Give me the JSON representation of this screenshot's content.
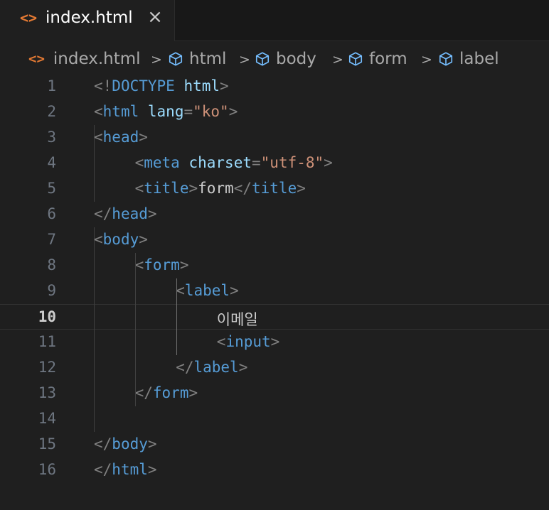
{
  "tab": {
    "icon": "<>",
    "label": "index.html",
    "close": "×"
  },
  "breadcrumb": {
    "file": "index.html",
    "items": [
      "html",
      "body",
      "form",
      "label"
    ]
  },
  "editor": {
    "active_line": 10,
    "line_numbers": [
      "1",
      "2",
      "3",
      "4",
      "5",
      "6",
      "7",
      "8",
      "9",
      "10",
      "11",
      "12",
      "13",
      "14",
      "15",
      "16"
    ],
    "lines": [
      [
        "<!",
        "DOCTYPE",
        " ",
        "html",
        ">"
      ],
      [
        "<",
        "html",
        " ",
        "lang",
        "=",
        "\"ko\"",
        ">"
      ],
      [
        "<",
        "head",
        ">"
      ],
      [
        "<",
        "meta",
        " ",
        "charset",
        "=",
        "\"utf-8\"",
        ">"
      ],
      [
        "<",
        "title",
        ">",
        "form",
        "</",
        "title",
        ">"
      ],
      [
        "</",
        "head",
        ">"
      ],
      [
        "<",
        "body",
        ">"
      ],
      [
        "<",
        "form",
        ">"
      ],
      [
        "<",
        "label",
        ">"
      ],
      [
        "이메일"
      ],
      [
        "<",
        "input",
        ">"
      ],
      [
        "</",
        "label",
        ">"
      ],
      [
        "</",
        "form",
        ">"
      ],
      [],
      [
        "</",
        "body",
        ">"
      ],
      [
        "</",
        "html",
        ">"
      ]
    ]
  },
  "colors": {
    "background": "#1f1f1f",
    "tag": "#569cd6",
    "attribute": "#9cdcfe",
    "string": "#ce9178",
    "bracket": "#808080",
    "text": "#cccccc",
    "file_icon": "#e37933"
  }
}
